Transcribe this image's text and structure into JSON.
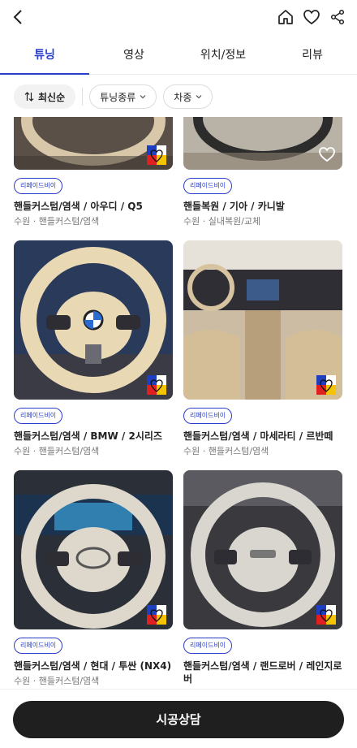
{
  "header": {
    "back_icon": "chevron-left-icon",
    "home_icon": "home-icon",
    "heart_icon": "heart-outline-icon",
    "share_icon": "share-icon"
  },
  "tabs": [
    {
      "label": "튜닝",
      "active": true
    },
    {
      "label": "영상",
      "active": false
    },
    {
      "label": "위치/정보",
      "active": false
    },
    {
      "label": "리뷰",
      "active": false
    }
  ],
  "filters": {
    "sort_label": "최신순",
    "tuning_type_label": "튜닝종류",
    "car_type_label": "차종"
  },
  "cards": [
    {
      "badge": "리페이드비이",
      "title": "핸들커스텀/염색 / 아우디 / Q5",
      "sub": "수원 · 핸들커스텀/염색",
      "overlay": "logo"
    },
    {
      "badge": "리페이드비이",
      "title": "핸들복원 / 기아 / 카니발",
      "sub": "수원 · 실내복원/교체",
      "overlay": "heart"
    },
    {
      "badge": "리페이드비이",
      "title": "핸들커스텀/염색 / BMW / 2시리즈",
      "sub": "수원 · 핸들커스텀/염색",
      "overlay": "logo"
    },
    {
      "badge": "리페이드비이",
      "title": "핸들커스텀/염색 / 마세라티 / 르반떼",
      "sub": "수원 · 핸들커스텀/염색",
      "overlay": "logo"
    },
    {
      "badge": "리페이드비이",
      "title": "핸들커스텀/염색 / 현대 / 투싼 (NX4)",
      "sub": "수원 · 핸들커스텀/염색",
      "overlay": "logo"
    },
    {
      "badge": "리페이드비이",
      "title": "핸들커스텀/염색 / 랜드로버 / 레인지로버",
      "sub": "",
      "overlay": "logo"
    }
  ],
  "cta": {
    "label": "시공상담"
  },
  "colors": {
    "accent": "#2a3ec9",
    "cta_bg": "#1f1f1f"
  }
}
